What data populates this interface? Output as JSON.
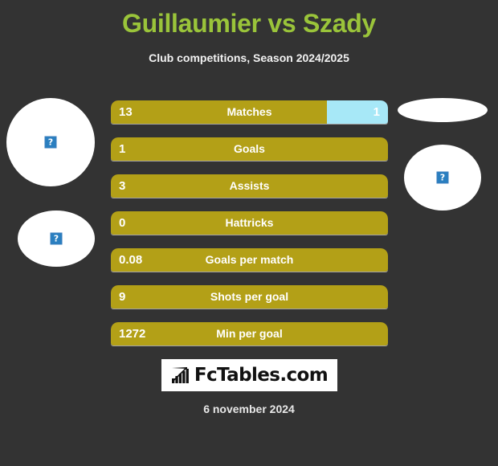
{
  "header": {
    "title": "Guillaumier vs Szady",
    "subtitle": "Club competitions, Season 2024/2025",
    "title_color": "#9ac43a",
    "subtitle_color": "#f2f2f2"
  },
  "theme": {
    "background": "#333333",
    "bar_primary": "#b3a017",
    "bar_secondary": "#a7e8f7",
    "text_on_bar": "#ffffff"
  },
  "players": {
    "left": {
      "avatar_top": {
        "icon": "broken-image-icon",
        "glyph": "?"
      },
      "avatar_bottom": {
        "icon": "broken-image-icon",
        "glyph": "?"
      }
    },
    "right": {
      "avatar_top": {
        "icon": "broken-image-icon",
        "glyph": ""
      },
      "avatar_bottom": {
        "icon": "broken-image-icon",
        "glyph": "?"
      }
    }
  },
  "stats": [
    {
      "label": "Matches",
      "left_value": "13",
      "right_value": "1",
      "left_pct": 78,
      "split": true
    },
    {
      "label": "Goals",
      "left_value": "1",
      "right_value": "",
      "left_pct": 100,
      "split": false
    },
    {
      "label": "Assists",
      "left_value": "3",
      "right_value": "",
      "left_pct": 100,
      "split": false
    },
    {
      "label": "Hattricks",
      "left_value": "0",
      "right_value": "",
      "left_pct": 100,
      "split": false
    },
    {
      "label": "Goals per match",
      "left_value": "0.08",
      "right_value": "",
      "left_pct": 100,
      "split": false
    },
    {
      "label": "Shots per goal",
      "left_value": "9",
      "right_value": "",
      "left_pct": 100,
      "split": false
    },
    {
      "label": "Min per goal",
      "left_value": "1272",
      "right_value": "",
      "left_pct": 100,
      "split": false
    }
  ],
  "footer": {
    "logo_text": "FcTables.com",
    "logo_icon": "bar-chart-growth-icon",
    "date": "6 november 2024"
  }
}
